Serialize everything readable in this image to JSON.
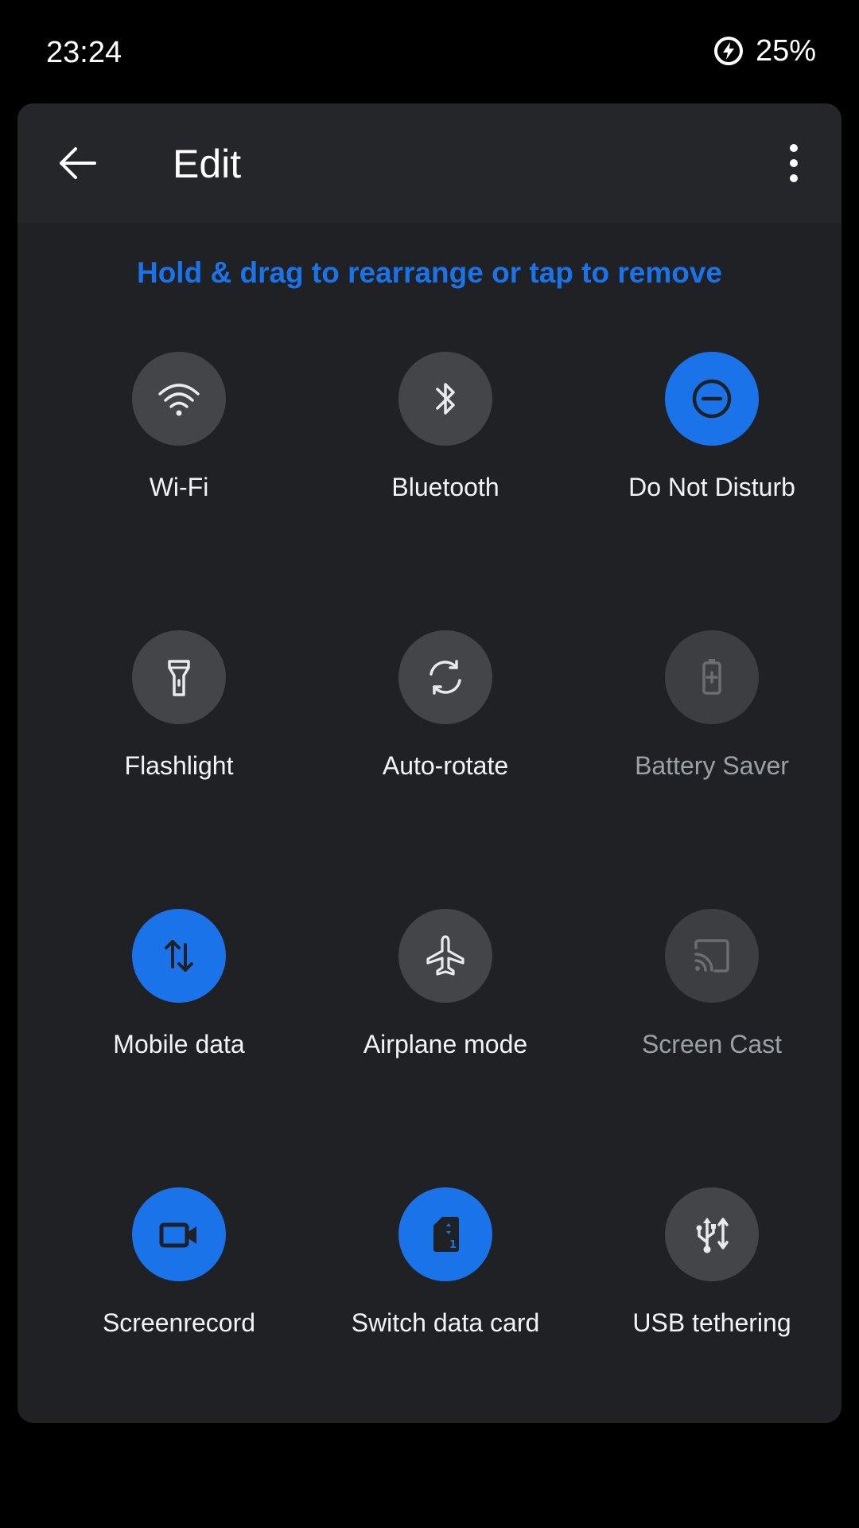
{
  "status_bar": {
    "time": "23:24",
    "battery_percent": "25%",
    "battery_icon": "battery-saver-bolt-icon"
  },
  "toolbar": {
    "back_icon": "arrow-back-icon",
    "title": "Edit",
    "more_icon": "more-vert-icon"
  },
  "hint": "Hold & drag to rearrange or tap to remove",
  "colors": {
    "active": "#1a73e8",
    "inactive": "#444548",
    "disabled": "#3d3e42",
    "panel": "#202124",
    "toolbar": "#25262a"
  },
  "tiles": [
    {
      "label": "Wi-Fi",
      "icon": "wifi-icon",
      "state": "inactive"
    },
    {
      "label": "Bluetooth",
      "icon": "bluetooth-icon",
      "state": "inactive"
    },
    {
      "label": "Do Not Disturb",
      "icon": "do-not-disturb-icon",
      "state": "active"
    },
    {
      "label": "Flashlight",
      "icon": "flashlight-icon",
      "state": "inactive"
    },
    {
      "label": "Auto-rotate",
      "icon": "auto-rotate-icon",
      "state": "inactive"
    },
    {
      "label": "Battery Saver",
      "icon": "battery-saver-icon",
      "state": "disabled"
    },
    {
      "label": "Mobile data",
      "icon": "mobile-data-icon",
      "state": "active"
    },
    {
      "label": "Airplane mode",
      "icon": "airplane-icon",
      "state": "inactive"
    },
    {
      "label": "Screen Cast",
      "icon": "cast-icon",
      "state": "disabled"
    },
    {
      "label": "Screenrecord",
      "icon": "videocam-icon",
      "state": "active"
    },
    {
      "label": "Switch data card",
      "icon": "sim-card-icon",
      "state": "active"
    },
    {
      "label": "USB tethering",
      "icon": "usb-icon",
      "state": "inactive"
    }
  ]
}
